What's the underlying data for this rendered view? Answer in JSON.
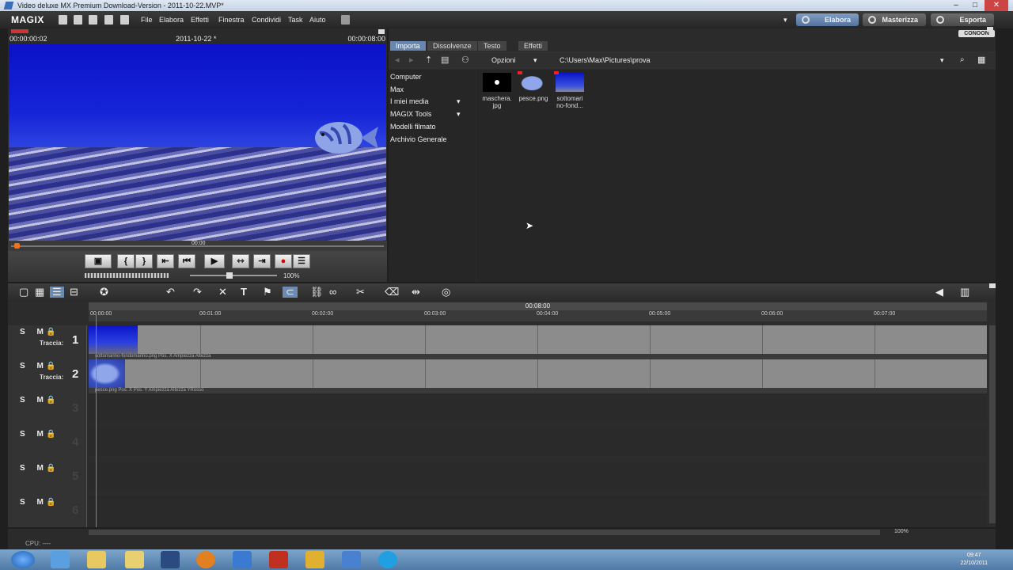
{
  "window": {
    "title": "Video deluxe MX Premium Download-Version - 2011-10-22.MVP*"
  },
  "menubar": {
    "logo": "MAGIX",
    "items": [
      "File",
      "Elabora",
      "Effetti",
      "Finestra",
      "Condividi",
      "Task",
      "Aiuto"
    ],
    "modes": [
      "Elabora",
      "Masterizza",
      "Esporta"
    ]
  },
  "preview": {
    "time_left": "00:00:00:02",
    "title": "2011-10-22 *",
    "time_right": "00:00:08:00",
    "seek_label": "00:00",
    "zoom": "100%"
  },
  "media": {
    "tabs": [
      "Importa",
      "Dissolvenze",
      "Testo",
      "Effetti"
    ],
    "options_label": "Opzioni",
    "path": "C:\\Users\\Max\\Pictures\\prova",
    "brand": "CONOON",
    "nav": [
      "Computer",
      "Max",
      "I miei media",
      "MAGIX Tools",
      "Modelli filmato",
      "Archivio Generale"
    ],
    "files": [
      {
        "name": "maschera.jpg",
        "line1": "maschera.",
        "line2": "jpg"
      },
      {
        "name": "pesce.png",
        "line1": "pesce.png",
        "line2": ""
      },
      {
        "name": "sottomarino-fond...",
        "line1": "sottomari",
        "line2": "no-fond..."
      }
    ]
  },
  "timeline": {
    "ruler_center": "00:08:00",
    "ticks": [
      "00:00:00",
      "00:01:00",
      "00:02:00",
      "00:03:00",
      "00:04:00",
      "00:05:00",
      "00:06:00",
      "00:07:00"
    ],
    "track_label": "Traccia:",
    "solo_mute": "S M",
    "tracks": [
      {
        "num": "1",
        "info": "sottomarino-fondomarino.png  Pos. X  Ampiezza  Altezza"
      },
      {
        "num": "2",
        "info": "pesce.png  Pos. X  Pos. Y  Ampiezza  Altezza  YRosso"
      },
      {
        "num": "3",
        "info": ""
      },
      {
        "num": "4",
        "info": ""
      },
      {
        "num": "5",
        "info": ""
      },
      {
        "num": "6",
        "info": ""
      }
    ]
  },
  "status": {
    "cpu": "CPU: ----",
    "zoom": "100%"
  },
  "clock": {
    "time": "09:47",
    "date": "22/10/2011"
  }
}
